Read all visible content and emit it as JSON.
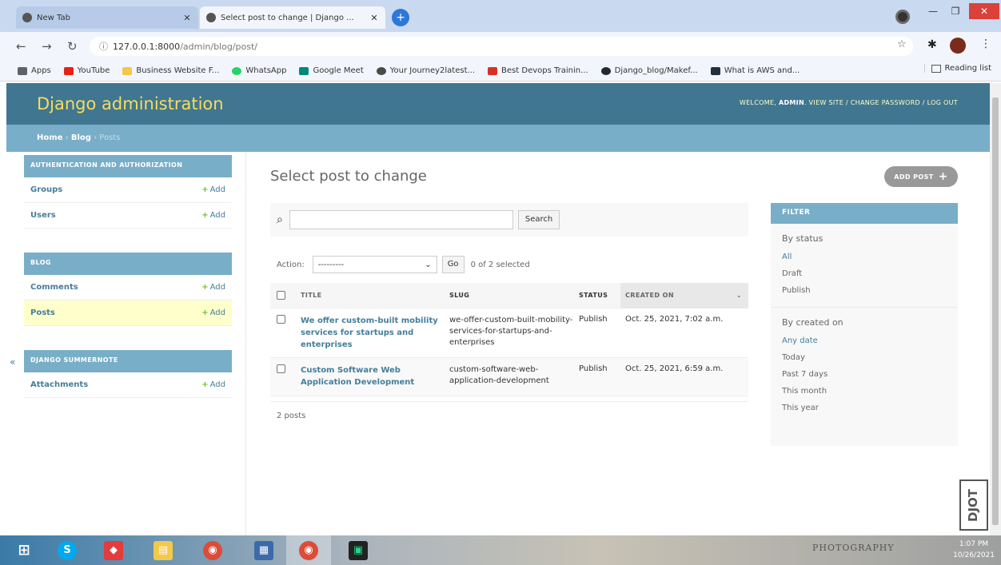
{
  "browser": {
    "tabs": [
      {
        "title": "New Tab",
        "active": false
      },
      {
        "title": "Select post to change | Django ...",
        "active": true
      }
    ],
    "new_tab_icon": "+",
    "url": {
      "host": "127.0.0.1:8000",
      "path": "/admin/blog/post/"
    },
    "bookmarks": [
      {
        "label": "Apps",
        "color": "#5f6368"
      },
      {
        "label": "YouTube",
        "color": "#e62117"
      },
      {
        "label": "Business Website F...",
        "color": "#f5c64a"
      },
      {
        "label": "WhatsApp",
        "color": "#25d366"
      },
      {
        "label": "Google Meet",
        "color": "#00897b"
      },
      {
        "label": "Your Journey2latest...",
        "color": "#4a4a4a"
      },
      {
        "label": "Best Devops Trainin...",
        "color": "#d93025"
      },
      {
        "label": "Django_blog/Makef...",
        "color": "#24292e"
      },
      {
        "label": "What is AWS and...",
        "color": "#232f3e"
      }
    ],
    "reading_list": "Reading list"
  },
  "admin": {
    "branding": "Django administration",
    "usertools": {
      "welcome": "WELCOME,",
      "user": "ADMIN",
      "links": "VIEW SITE / CHANGE PASSWORD / LOG OUT"
    },
    "breadcrumbs": {
      "home": "Home",
      "sep1": "›",
      "app": "Blog",
      "sep2": "›",
      "current": "Posts"
    },
    "sidebar": {
      "modules": [
        {
          "caption": "AUTHENTICATION AND AUTHORIZATION",
          "rows": [
            {
              "name": "Groups",
              "add": "Add"
            },
            {
              "name": "Users",
              "add": "Add"
            }
          ]
        },
        {
          "caption": "BLOG",
          "rows": [
            {
              "name": "Comments",
              "add": "Add"
            },
            {
              "name": "Posts",
              "add": "Add"
            }
          ]
        },
        {
          "caption": "DJANGO SUMMERNOTE",
          "rows": [
            {
              "name": "Attachments",
              "add": "Add"
            }
          ]
        }
      ],
      "collapse": "«"
    },
    "title": "Select post to change",
    "add_button": "ADD POST",
    "search_button": "Search",
    "action_label": "Action:",
    "action_placeholder": "---------",
    "go_button": "Go",
    "selected_count": "0 of 2 selected",
    "columns": {
      "title": "TITLE",
      "slug": "SLUG",
      "status": "STATUS",
      "created": "CREATED ON"
    },
    "rows": [
      {
        "title": "We offer custom-built mobility services for startups and enterprises",
        "slug": "we-offer-custom-built-mobility-services-for-startups-and-enterprises",
        "status": "Publish",
        "created": "Oct. 25, 2021, 7:02 a.m."
      },
      {
        "title": "Custom Software Web Application Development",
        "slug": "custom-software-web-application-development",
        "status": "Publish",
        "created": "Oct. 25, 2021, 6:59 a.m."
      }
    ],
    "paginator": "2 posts",
    "filter": {
      "heading": "FILTER",
      "groups": [
        {
          "title": "By status",
          "options": [
            "All",
            "Draft",
            "Publish"
          ]
        },
        {
          "title": "By created on",
          "options": [
            "Any date",
            "Today",
            "Past 7 days",
            "This month",
            "This year"
          ]
        }
      ]
    }
  },
  "taskbar": {
    "clock_time": "1:07 PM",
    "clock_date": "10/26/2021",
    "stamp": "PHOTOGRAPHY"
  },
  "colors": {
    "header": "#417690",
    "breadcrumb": "#79aec8",
    "link": "#447e9b",
    "branding": "#f5dd5d"
  }
}
